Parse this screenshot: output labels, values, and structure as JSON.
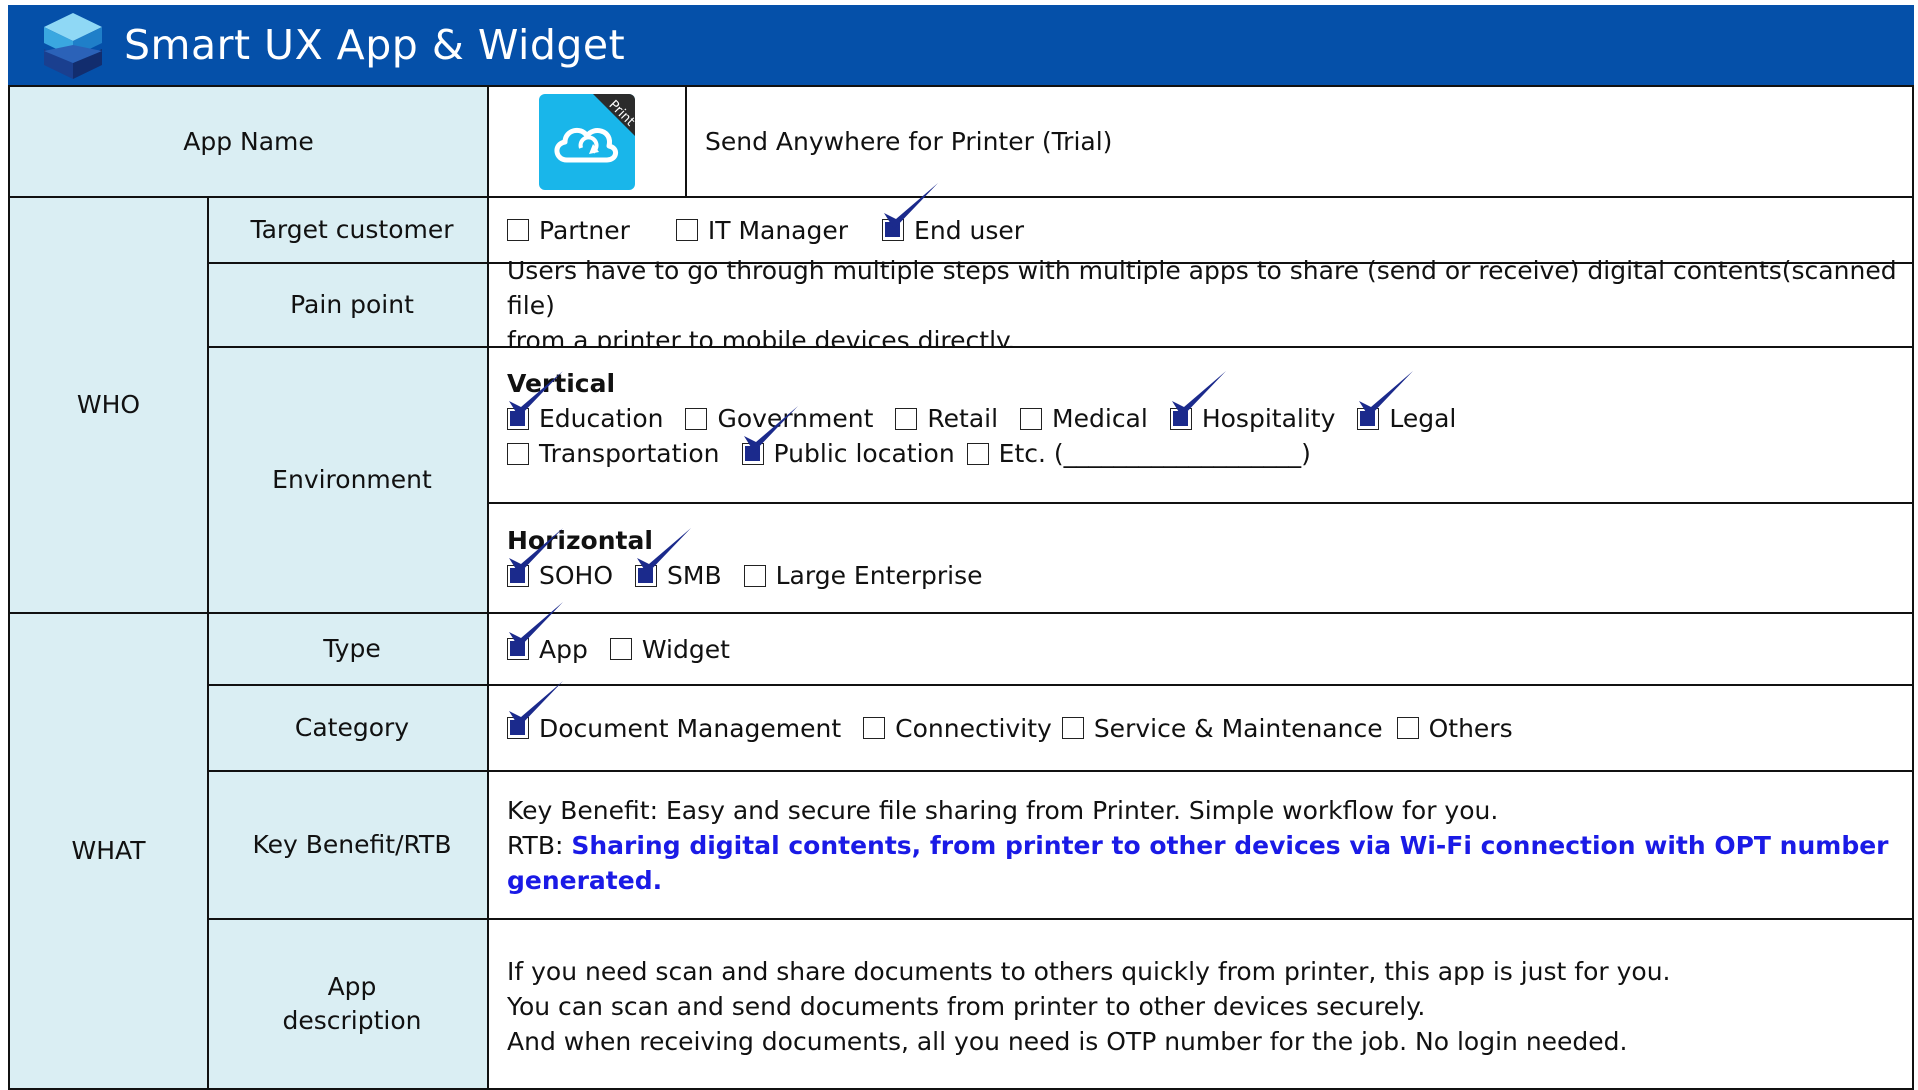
{
  "header": {
    "title": "Smart UX App & Widget",
    "logo_icon": "cube-stack-icon"
  },
  "colors": {
    "header_bg": "#0550a9",
    "label_bg": "#daeef3",
    "check": "#1b2a8c",
    "rtb": "#1a1ae6",
    "app_icon_bg": "#19b6ea"
  },
  "app_name": {
    "label": "App Name",
    "icon": "cloud-share-icon",
    "icon_ribbon": "Print",
    "value": "Send Anywhere for Printer (Trial)"
  },
  "who": {
    "label": "WHO",
    "target_customer": {
      "label": "Target customer",
      "options": [
        {
          "text": "Partner",
          "checked": false
        },
        {
          "text": "IT Manager",
          "checked": false
        },
        {
          "text": "End user",
          "checked": true
        }
      ]
    },
    "pain_point": {
      "label": "Pain point",
      "lines": [
        "Users have to go through multiple steps with multiple apps to share (send or receive) digital contents(scanned file)",
        "from a printer to mobile devices directly."
      ]
    },
    "environment": {
      "label": "Environment",
      "vertical": {
        "title": "Vertical",
        "row1": [
          {
            "text": "Education",
            "checked": true
          },
          {
            "text": "Government",
            "checked": false
          },
          {
            "text": "Retail",
            "checked": false
          },
          {
            "text": "Medical",
            "checked": false
          },
          {
            "text": "Hospitality",
            "checked": true
          },
          {
            "text": "Legal",
            "checked": true
          }
        ],
        "row2": [
          {
            "text": "Transportation",
            "checked": false
          },
          {
            "text": "Public location",
            "checked": true
          },
          {
            "text": "Etc. (___________________)",
            "checked": false
          }
        ]
      },
      "horizontal": {
        "title": "Horizontal",
        "options": [
          {
            "text": "SOHO",
            "checked": true
          },
          {
            "text": "SMB",
            "checked": true
          },
          {
            "text": "Large Enterprise",
            "checked": false
          }
        ]
      }
    }
  },
  "what": {
    "label": "WHAT",
    "type": {
      "label": "Type",
      "options": [
        {
          "text": "App",
          "checked": true
        },
        {
          "text": "Widget",
          "checked": false
        }
      ]
    },
    "category": {
      "label": "Category",
      "options": [
        {
          "text": "Document Management",
          "checked": true
        },
        {
          "text": "Connectivity",
          "checked": false
        },
        {
          "text": "Service & Maintenance",
          "checked": false
        },
        {
          "text": "Others",
          "checked": false
        }
      ]
    },
    "key_benefit": {
      "label": "Key Benefit/RTB",
      "benefit": "Key Benefit: Easy and secure file sharing from Printer. Simple workflow for you.",
      "rtb_prefix": "RTB: ",
      "rtb_text": "Sharing digital contents, from printer to other devices via Wi-Fi connection with OPT number generated."
    },
    "description": {
      "label_line1": "App",
      "label_line2": "description",
      "lines": [
        "If you need scan and share documents to others quickly from printer, this app is just for you.",
        "You can scan and send documents from printer to other devices securely.",
        "And when receiving documents, all  you need is OTP number for the job. No login needed."
      ]
    }
  }
}
